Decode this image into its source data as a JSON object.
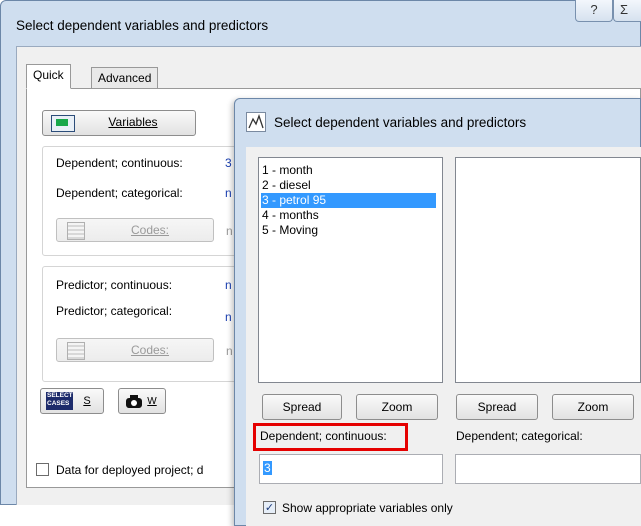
{
  "outer_window": {
    "title": "Select dependent variables and predictors",
    "help_glyph": "?",
    "close_glyph": "Σ"
  },
  "tabs": [
    {
      "label": "Quick"
    },
    {
      "label": "Advanced"
    }
  ],
  "variables_button": {
    "label": "Variables"
  },
  "dependent_group": {
    "continuous_label": "Dependent; continuous:",
    "continuous_value": "3",
    "categorical_label": "Dependent; categorical:",
    "categorical_value": "n",
    "codes_label": "Codes:",
    "codes_value": "n"
  },
  "predictor_group": {
    "continuous_label": "Predictor; continuous:",
    "continuous_value": "n",
    "categorical_label": "Predictor; categorical:",
    "categorical_value": "n",
    "codes_label": "Codes:",
    "codes_value": "n"
  },
  "select_cases": {
    "icon_text_line1": "SELECT",
    "icon_text_line2": "CASES",
    "key": "S"
  },
  "weight": {
    "key": "W"
  },
  "deployed_checkbox": {
    "label": "Data for deployed project; d",
    "checked": false
  },
  "inner_dialog": {
    "title": "Select dependent variables and predictors",
    "variable_list": [
      {
        "label": "1 - month",
        "selected": false
      },
      {
        "label": "2 - diesel",
        "selected": false
      },
      {
        "label": "3 - petrol 95",
        "selected": true
      },
      {
        "label": "4 - months",
        "selected": false
      },
      {
        "label": "5 - Moving",
        "selected": false
      }
    ],
    "left_spread": "Spread",
    "left_zoom": "Zoom",
    "right_spread": "Spread",
    "right_zoom": "Zoom",
    "dependent_continuous_label": "Dependent; continuous:",
    "dependent_continuous_value": "3",
    "dependent_categorical_label": "Dependent; categorical:",
    "dependent_categorical_value": "",
    "show_appropriate_label": "Show appropriate variables only",
    "show_appropriate_checked": true
  },
  "colors": {
    "selection": "#3399ff",
    "highlight_box": "#e50000",
    "value_text": "#1a3fb0",
    "title_bar": "#cfdeef"
  }
}
